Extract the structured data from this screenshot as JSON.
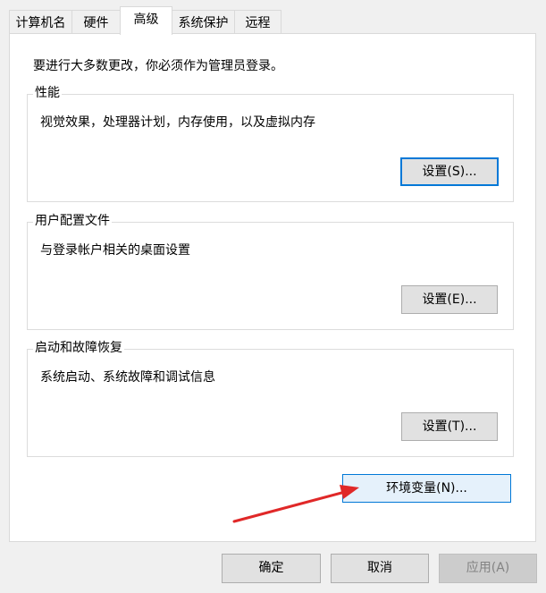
{
  "tabs": [
    {
      "label": "计算机名"
    },
    {
      "label": "硬件"
    },
    {
      "label": "高级",
      "active": true
    },
    {
      "label": "系统保护"
    },
    {
      "label": "远程"
    }
  ],
  "notice": "要进行大多数更改，你必须作为管理员登录。",
  "groups": {
    "performance": {
      "title": "性能",
      "desc": "视觉效果，处理器计划，内存使用，以及虚拟内存",
      "button": "设置(S)..."
    },
    "user_profiles": {
      "title": "用户配置文件",
      "desc": "与登录帐户相关的桌面设置",
      "button": "设置(E)..."
    },
    "startup_recovery": {
      "title": "启动和故障恢复",
      "desc": "系统启动、系统故障和调试信息",
      "button": "设置(T)..."
    }
  },
  "env_button": "环境变量(N)...",
  "dialog_buttons": {
    "ok": "确定",
    "cancel": "取消",
    "apply": "应用(A)"
  },
  "colors": {
    "accent": "#0078d7",
    "annotation_arrow": "#e02828"
  }
}
